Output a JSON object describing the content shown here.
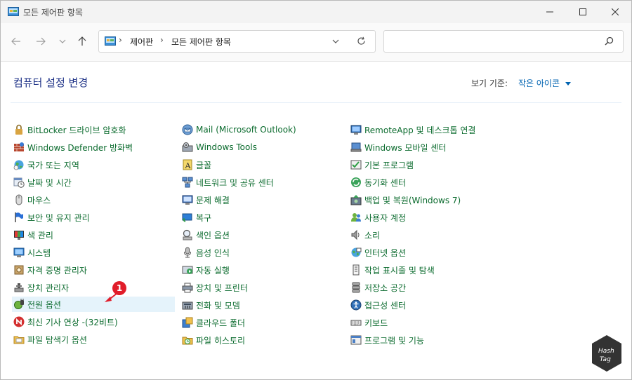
{
  "window": {
    "title": "모든 제어판 항목"
  },
  "address": {
    "crumb1": "제어판",
    "crumb2": "모든 제어판 항목"
  },
  "search": {
    "value": "",
    "placeholder": ""
  },
  "main": {
    "heading": "컴퓨터 설정 변경",
    "view_by_label": "보기 기준:",
    "view_by_value": "작은 아이콘"
  },
  "annotation": {
    "badge": "1"
  },
  "watermark": {
    "text": "HashTag"
  },
  "items": {
    "col1": [
      {
        "label": "BitLocker 드라이브 암호화",
        "icon": "bitlocker-icon"
      },
      {
        "label": "Windows Defender 방화벽",
        "icon": "firewall-icon"
      },
      {
        "label": "국가 또는 지역",
        "icon": "region-icon"
      },
      {
        "label": "날짜 및 시간",
        "icon": "datetime-icon"
      },
      {
        "label": "마우스",
        "icon": "mouse-icon"
      },
      {
        "label": "보안 및 유지 관리",
        "icon": "flag-icon"
      },
      {
        "label": "색 관리",
        "icon": "color-management-icon"
      },
      {
        "label": "시스템",
        "icon": "system-icon"
      },
      {
        "label": "자격 증명 관리자",
        "icon": "credential-icon"
      },
      {
        "label": "장치 관리자",
        "icon": "device-manager-icon"
      },
      {
        "label": "전원 옵션",
        "icon": "power-icon"
      },
      {
        "label": "최신 기사 연상 -(32비트)",
        "icon": "news-icon"
      },
      {
        "label": "파일 탐색기 옵션",
        "icon": "folder-options-icon"
      }
    ],
    "col2": [
      {
        "label": "Mail (Microsoft Outlook)",
        "icon": "mail-icon"
      },
      {
        "label": "Windows Tools",
        "icon": "tools-icon"
      },
      {
        "label": "글꼴",
        "icon": "fonts-icon"
      },
      {
        "label": "네트워크 및 공유 센터",
        "icon": "network-icon"
      },
      {
        "label": "문제 해결",
        "icon": "troubleshoot-icon"
      },
      {
        "label": "복구",
        "icon": "recovery-icon"
      },
      {
        "label": "색인 옵션",
        "icon": "indexing-icon"
      },
      {
        "label": "음성 인식",
        "icon": "microphone-icon"
      },
      {
        "label": "자동 실행",
        "icon": "autoplay-icon"
      },
      {
        "label": "장치 및 프린터",
        "icon": "printer-icon"
      },
      {
        "label": "전화 및 모뎀",
        "icon": "phone-modem-icon"
      },
      {
        "label": "클라우드 폴더",
        "icon": "cloud-folder-icon"
      },
      {
        "label": "파일 히스토리",
        "icon": "file-history-icon"
      }
    ],
    "col3": [
      {
        "label": "RemoteApp 및 데스크톱 연결",
        "icon": "remoteapp-icon"
      },
      {
        "label": "Windows 모바일 센터",
        "icon": "mobility-icon"
      },
      {
        "label": "기본 프로그램",
        "icon": "default-programs-icon"
      },
      {
        "label": "동기화 센터",
        "icon": "sync-icon"
      },
      {
        "label": "백업 및 복원(Windows 7)",
        "icon": "backup-icon"
      },
      {
        "label": "사용자 계정",
        "icon": "user-accounts-icon"
      },
      {
        "label": "소리",
        "icon": "sound-icon"
      },
      {
        "label": "인터넷 옵션",
        "icon": "internet-options-icon"
      },
      {
        "label": "작업 표시줄 및 탐색",
        "icon": "taskbar-icon"
      },
      {
        "label": "저장소 공간",
        "icon": "storage-icon"
      },
      {
        "label": "접근성 센터",
        "icon": "accessibility-icon"
      },
      {
        "label": "키보드",
        "icon": "keyboard-icon"
      },
      {
        "label": "프로그램 및 기능",
        "icon": "programs-icon"
      }
    ]
  }
}
